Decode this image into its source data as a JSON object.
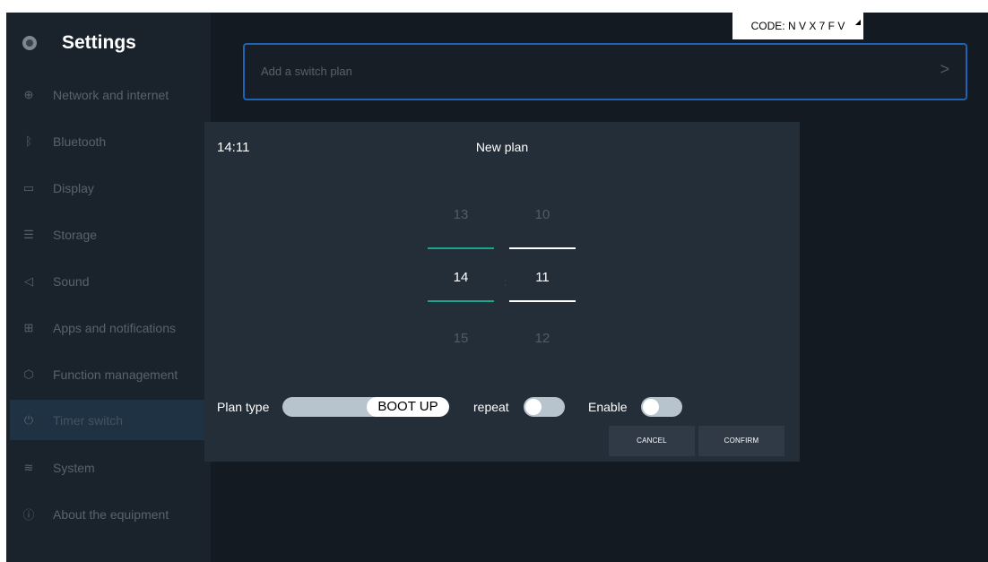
{
  "code_tag": {
    "text": "CODE: N V X 7 F V"
  },
  "sidebar": {
    "title": "Settings",
    "items": [
      {
        "label": "Network and internet",
        "icon": "globe-icon"
      },
      {
        "label": "Bluetooth",
        "icon": "bluetooth-icon"
      },
      {
        "label": "Display",
        "icon": "monitor-icon"
      },
      {
        "label": "Storage",
        "icon": "storage-icon"
      },
      {
        "label": "Sound",
        "icon": "speaker-icon"
      },
      {
        "label": "Apps and notifications",
        "icon": "apps-grid-icon"
      },
      {
        "label": "Function management",
        "icon": "cube-icon"
      },
      {
        "label": "Timer switch",
        "icon": "power-icon"
      },
      {
        "label": "System",
        "icon": "sliders-icon"
      },
      {
        "label": "About the equipment",
        "icon": "info-icon"
      }
    ],
    "active_item": "Timer switch"
  },
  "main": {
    "add_plan_label": "Add a switch plan"
  },
  "dialog": {
    "time": "14:11",
    "title": "New plan",
    "hour_picker": {
      "prev": "13",
      "current": "14",
      "next": "15"
    },
    "minute_picker": {
      "prev": "10",
      "current": "11",
      "next": "12"
    },
    "plan_type_label": "Plan type",
    "plan_type_value": "BOOT UP",
    "repeat_label": "repeat",
    "enable_label": "Enable",
    "cancel_label": "CANCEL",
    "confirm_label": "CONFIRM"
  },
  "colors": {
    "accent_teal": "#1aa58f",
    "accent_blue": "#1f63b6",
    "background": "#141a21",
    "dialog": "#242e39"
  }
}
